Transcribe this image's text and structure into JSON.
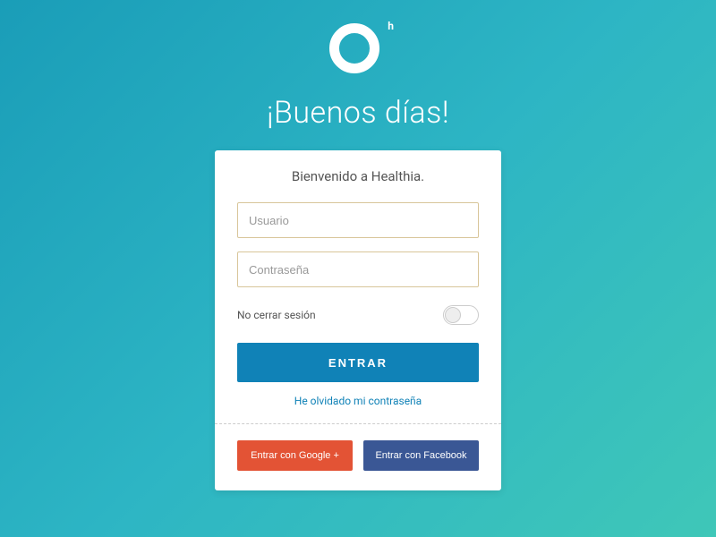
{
  "logo": {
    "superscript": "h"
  },
  "greeting": "¡Buenos días!",
  "card": {
    "welcome": "Bienvenido a Healthia.",
    "username_placeholder": "Usuario",
    "password_placeholder": "Contraseña",
    "remember_label": "No cerrar sesión",
    "login_button": "ENTRAR",
    "forgot_link": "He olvidado mi contraseña",
    "google_button": "Entrar con Google +",
    "facebook_button": "Entrar con Facebook"
  }
}
